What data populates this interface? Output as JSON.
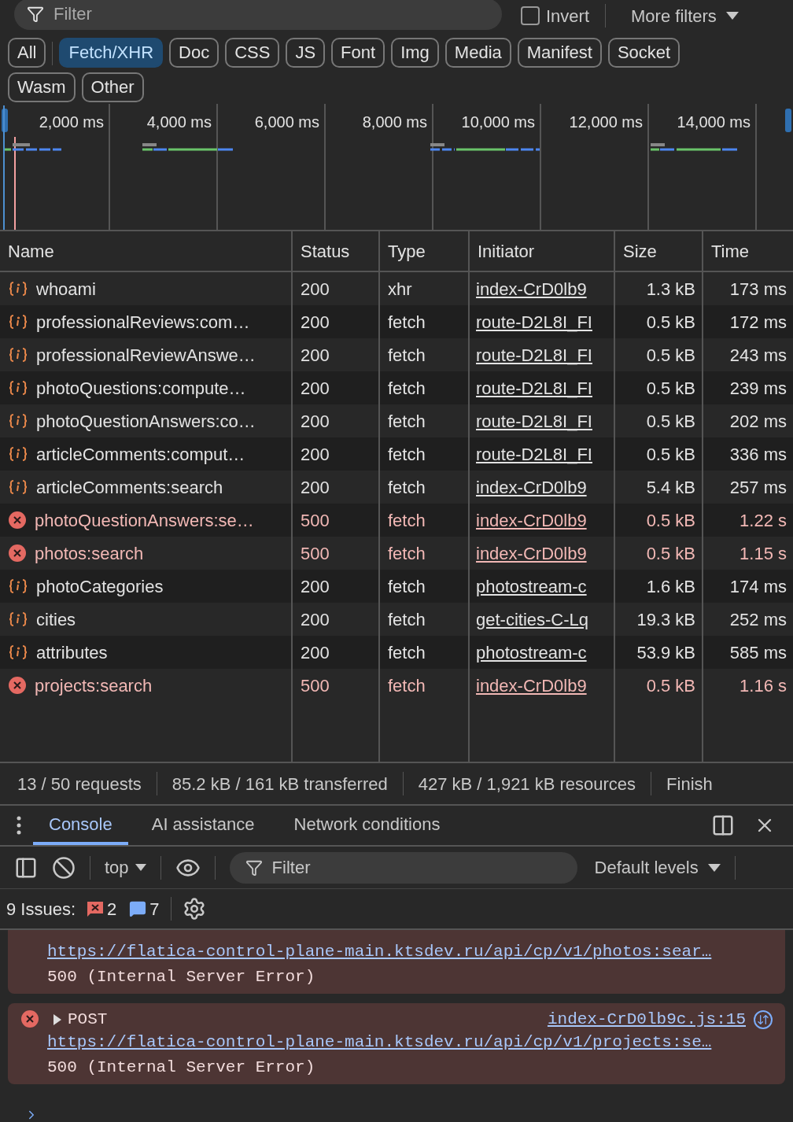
{
  "filter_bar": {
    "placeholder": "Filter",
    "invert": {
      "label": "Invert",
      "checked": false
    },
    "more_filters": "More filters"
  },
  "type_filters": [
    {
      "label": "All",
      "selected": false
    },
    {
      "label": "Fetch/XHR",
      "selected": true
    },
    {
      "label": "Doc",
      "selected": false
    },
    {
      "label": "CSS",
      "selected": false
    },
    {
      "label": "JS",
      "selected": false
    },
    {
      "label": "Font",
      "selected": false
    },
    {
      "label": "Img",
      "selected": false
    },
    {
      "label": "Media",
      "selected": false
    },
    {
      "label": "Manifest",
      "selected": false
    },
    {
      "label": "Socket",
      "selected": false
    },
    {
      "label": "Wasm",
      "selected": false
    },
    {
      "label": "Other",
      "selected": false
    }
  ],
  "timeline": {
    "ticks": [
      "2,000 ms",
      "4,000 ms",
      "6,000 ms",
      "8,000 ms",
      "10,000 ms",
      "12,000 ms",
      "14,000 ms"
    ]
  },
  "table": {
    "columns": [
      "Name",
      "Status",
      "Type",
      "Initiator",
      "Size",
      "Time"
    ],
    "rows": [
      {
        "name": "whoami",
        "status": "200",
        "type": "xhr",
        "initiator": "index-CrD0lb9",
        "size": "1.3 kB",
        "time": "173 ms",
        "error": false
      },
      {
        "name": "professionalReviews:com…",
        "status": "200",
        "type": "fetch",
        "initiator": "route-D2L8I_FI",
        "size": "0.5 kB",
        "time": "172 ms",
        "error": false
      },
      {
        "name": "professionalReviewAnswe…",
        "status": "200",
        "type": "fetch",
        "initiator": "route-D2L8I_FI",
        "size": "0.5 kB",
        "time": "243 ms",
        "error": false
      },
      {
        "name": "photoQuestions:compute…",
        "status": "200",
        "type": "fetch",
        "initiator": "route-D2L8I_FI",
        "size": "0.5 kB",
        "time": "239 ms",
        "error": false
      },
      {
        "name": "photoQuestionAnswers:co…",
        "status": "200",
        "type": "fetch",
        "initiator": "route-D2L8I_FI",
        "size": "0.5 kB",
        "time": "202 ms",
        "error": false
      },
      {
        "name": "articleComments:comput…",
        "status": "200",
        "type": "fetch",
        "initiator": "route-D2L8I_FI",
        "size": "0.5 kB",
        "time": "336 ms",
        "error": false
      },
      {
        "name": "articleComments:search",
        "status": "200",
        "type": "fetch",
        "initiator": "index-CrD0lb9",
        "size": "5.4 kB",
        "time": "257 ms",
        "error": false
      },
      {
        "name": "photoQuestionAnswers:se…",
        "status": "500",
        "type": "fetch",
        "initiator": "index-CrD0lb9",
        "size": "0.5 kB",
        "time": "1.22 s",
        "error": true
      },
      {
        "name": "photos:search",
        "status": "500",
        "type": "fetch",
        "initiator": "index-CrD0lb9",
        "size": "0.5 kB",
        "time": "1.15 s",
        "error": true
      },
      {
        "name": "photoCategories",
        "status": "200",
        "type": "fetch",
        "initiator": "photostream-c",
        "size": "1.6 kB",
        "time": "174 ms",
        "error": false
      },
      {
        "name": "cities",
        "status": "200",
        "type": "fetch",
        "initiator": "get-cities-C-Lq",
        "size": "19.3 kB",
        "time": "252 ms",
        "error": false
      },
      {
        "name": "attributes",
        "status": "200",
        "type": "fetch",
        "initiator": "photostream-c",
        "size": "53.9 kB",
        "time": "585 ms",
        "error": false
      },
      {
        "name": "projects:search",
        "status": "500",
        "type": "fetch",
        "initiator": "index-CrD0lb9",
        "size": "0.5 kB",
        "time": "1.16 s",
        "error": true
      }
    ]
  },
  "status_bar": [
    "13 / 50 requests",
    "85.2 kB / 161 kB transferred",
    "427 kB / 1,921 kB resources",
    "Finish"
  ],
  "drawer_tabs": [
    {
      "label": "Console",
      "selected": true
    },
    {
      "label": "AI assistance",
      "selected": false
    },
    {
      "label": "Network conditions",
      "selected": false
    }
  ],
  "console_toolbar": {
    "context": "top",
    "filter_placeholder": "Filter",
    "levels": "Default levels"
  },
  "issues": {
    "label": "9 Issues:",
    "errors": "2",
    "info": "7"
  },
  "messages": [
    {
      "url": "https://flatica-control-plane-main.ktsdev.ru/api/cp/v1/photos:sear…",
      "text": "500 (Internal Server Error)"
    },
    {
      "method": "POST",
      "source": "index-CrD0lb9c.js:15",
      "url": "https://flatica-control-plane-main.ktsdev.ru/api/cp/v1/projects:se…",
      "text": "500 (Internal Server Error)"
    }
  ]
}
